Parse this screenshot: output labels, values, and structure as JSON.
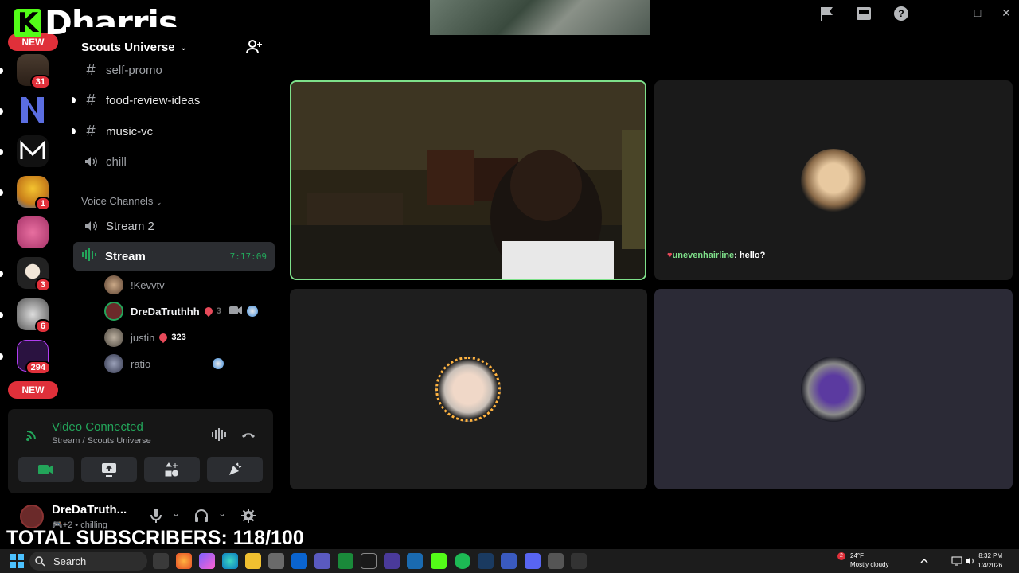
{
  "overlay": {
    "logo_letter": "K",
    "logo_name": "Dharris",
    "subscribers": "TOTAL SUBSCRIBERS: 118/100"
  },
  "rail": {
    "new_label_top": "NEW",
    "new_label_bottom": "NEW",
    "badges": [
      "31",
      "1",
      "3",
      "6",
      "294"
    ]
  },
  "guild": {
    "name": "Scouts Universe",
    "channels": [
      {
        "label": "self-promo",
        "type": "text"
      },
      {
        "label": "food-review-ideas",
        "type": "text"
      },
      {
        "label": "music-vc",
        "type": "text"
      },
      {
        "label": "chill",
        "type": "voice"
      }
    ],
    "voice_category": "Voice Channels",
    "voice_channels": [
      {
        "label": "Stream 2"
      },
      {
        "label": "Stream",
        "timer": "7:17:09"
      }
    ],
    "users": [
      {
        "name": "!Kevvtv"
      },
      {
        "name": "DreDaTruthhh",
        "count": "3"
      },
      {
        "name": "justin",
        "count": "323"
      },
      {
        "name": "ratio"
      }
    ]
  },
  "voice_panel": {
    "title": "Video Connected",
    "subtitle": "Stream / Scouts Universe"
  },
  "user_panel": {
    "name": "DreDaTruth...",
    "status_extra": "+2",
    "status": "chilling"
  },
  "stage": {
    "chat_user": "unevenhairline",
    "chat_text": "hello?"
  },
  "taskbar": {
    "search": "Search",
    "weather_temp": "24°F",
    "weather_desc": "Mostly cloudy",
    "time": "8:32 PM",
    "date": "1/4/2026",
    "notif_count": "2"
  },
  "colors": {
    "accent_green": "#23a55a",
    "kick_green": "#53fc18",
    "badge_red": "#e0303a"
  }
}
